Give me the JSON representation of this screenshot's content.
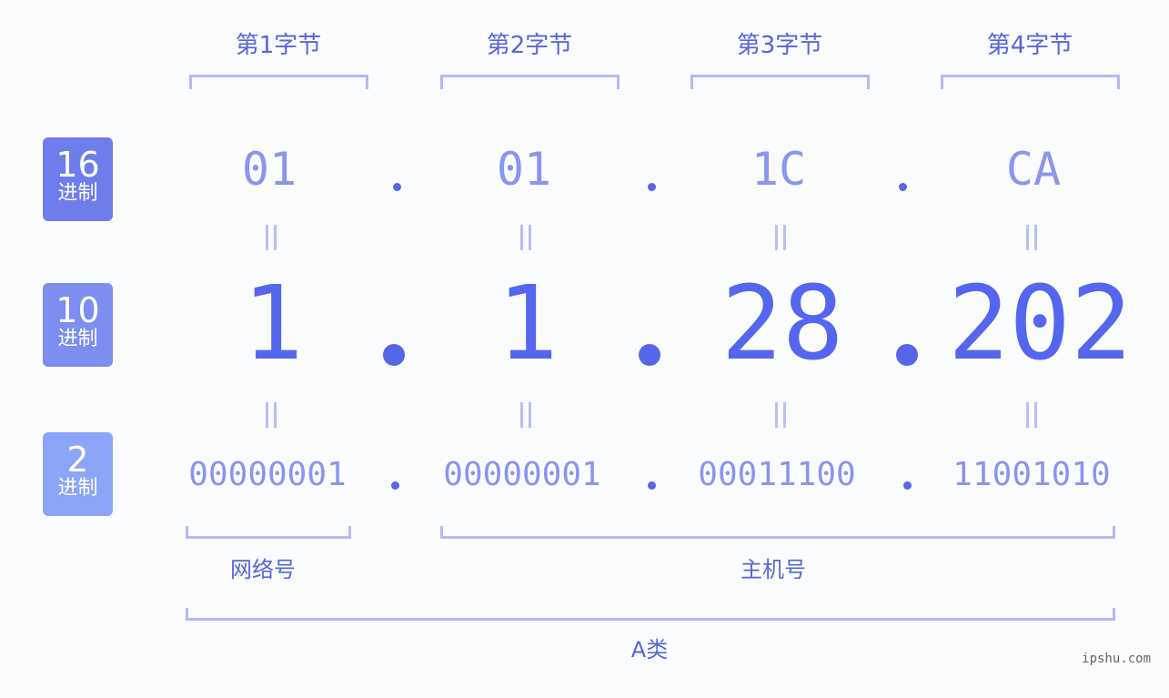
{
  "ip_address": "1.1.28.202",
  "bytes": [
    {
      "label": "第1字节",
      "hex": "01",
      "dec": "1",
      "bin": "00000001"
    },
    {
      "label": "第2字节",
      "hex": "01",
      "dec": "1",
      "bin": "00000001"
    },
    {
      "label": "第3字节",
      "hex": "1C",
      "dec": "28",
      "bin": "00011100"
    },
    {
      "label": "第4字节",
      "hex": "CA",
      "dec": "202",
      "bin": "11001010"
    }
  ],
  "rows": [
    {
      "base": "16",
      "label": "进制",
      "color": "#6e7deb"
    },
    {
      "base": "10",
      "label": "进制",
      "color": "#7d8df0"
    },
    {
      "base": "2",
      "label": "进制",
      "color": "#8ca5f6"
    }
  ],
  "sections": {
    "network": "网络号",
    "host": "主机号",
    "class": "A类"
  },
  "watermark": "ipshu.com",
  "colors": {
    "accent": "#5566ee",
    "light_accent": "#8a95ee",
    "bracket": "#b3baf5"
  }
}
